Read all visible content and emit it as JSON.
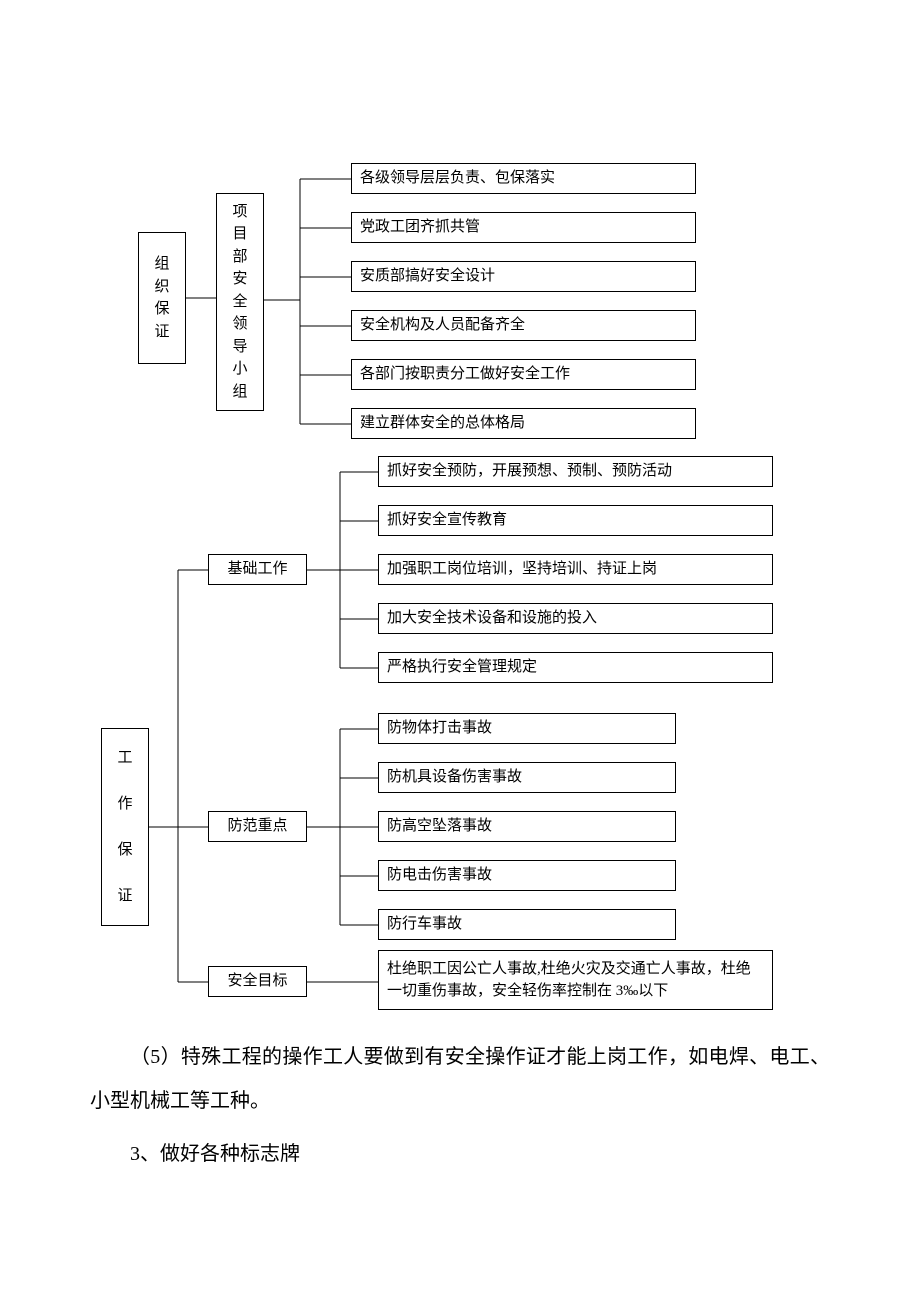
{
  "chart_data": {
    "type": "tree",
    "roots": [
      {
        "label": "组织保证",
        "children": [
          {
            "label": "项目部安全领导小组",
            "children": [
              {
                "label": "各级领导层层负责、包保落实"
              },
              {
                "label": "党政工团齐抓共管"
              },
              {
                "label": "安质部搞好安全设计"
              },
              {
                "label": "安全机构及人员配备齐全"
              },
              {
                "label": "各部门按职责分工做好安全工作"
              },
              {
                "label": "建立群体安全的总体格局"
              }
            ]
          }
        ]
      },
      {
        "label": "工作保证",
        "children": [
          {
            "label": "基础工作",
            "children": [
              {
                "label": "抓好安全预防，开展预想、预制、预防活动"
              },
              {
                "label": "抓好安全宣传教育"
              },
              {
                "label": "加强职工岗位培训，坚持培训、持证上岗"
              },
              {
                "label": "加大安全技术设备和设施的投入"
              },
              {
                "label": "严格执行安全管理规定"
              }
            ]
          },
          {
            "label": "防范重点",
            "children": [
              {
                "label": "防物体打击事故"
              },
              {
                "label": "防机具设备伤害事故"
              },
              {
                "label": "防高空坠落事故"
              },
              {
                "label": "防电击伤害事故"
              },
              {
                "label": "防行车事故"
              }
            ]
          },
          {
            "label": "安全目标",
            "children": [
              {
                "label": "杜绝职工因公亡人事故,杜绝火灾及交通亡人事故，杜绝一切重伤事故，安全轻伤率控制在 3‰以下"
              }
            ]
          }
        ]
      }
    ]
  },
  "root1": {
    "c1": "组",
    "c2": "织",
    "c3": "保",
    "c4": "证"
  },
  "mid1": {
    "c1": "项",
    "c2": "目",
    "c3": "部",
    "c4": "安",
    "c5": "全",
    "c6": "领",
    "c7": "导",
    "c8": "小",
    "c9": "组"
  },
  "leaves1": {
    "a": "各级领导层层负责、包保落实",
    "b": "党政工团齐抓共管",
    "c": "安质部搞好安全设计",
    "d": "安全机构及人员配备齐全",
    "e": "各部门按职责分工做好安全工作",
    "f": "建立群体安全的总体格局"
  },
  "root2": {
    "c1": "工",
    "c2": "作",
    "c3": "保",
    "c4": "证"
  },
  "mid2a": "基础工作",
  "mid2b": "防范重点",
  "mid2c": "安全目标",
  "leaves2a": {
    "a": "抓好安全预防，开展预想、预制、预防活动",
    "b": "抓好安全宣传教育",
    "c": "加强职工岗位培训，坚持培训、持证上岗",
    "d": "加大安全技术设备和设施的投入",
    "e": "严格执行安全管理规定"
  },
  "leaves2b": {
    "a": "防物体打击事故",
    "b": "防机具设备伤害事故",
    "c": "防高空坠落事故",
    "d": "防电击伤害事故",
    "e": "防行车事故"
  },
  "leaves2c": {
    "a": "杜绝职工因公亡人事故,杜绝火灾及交通亡人事故，杜绝一切重伤事故，安全轻伤率控制在 3‰以下"
  },
  "text": {
    "p1": "（5）特殊工程的操作工人要做到有安全操作证才能上岗工作，如电焊、电工、小型机械工等工种。",
    "p2": "3、做好各种标志牌"
  }
}
